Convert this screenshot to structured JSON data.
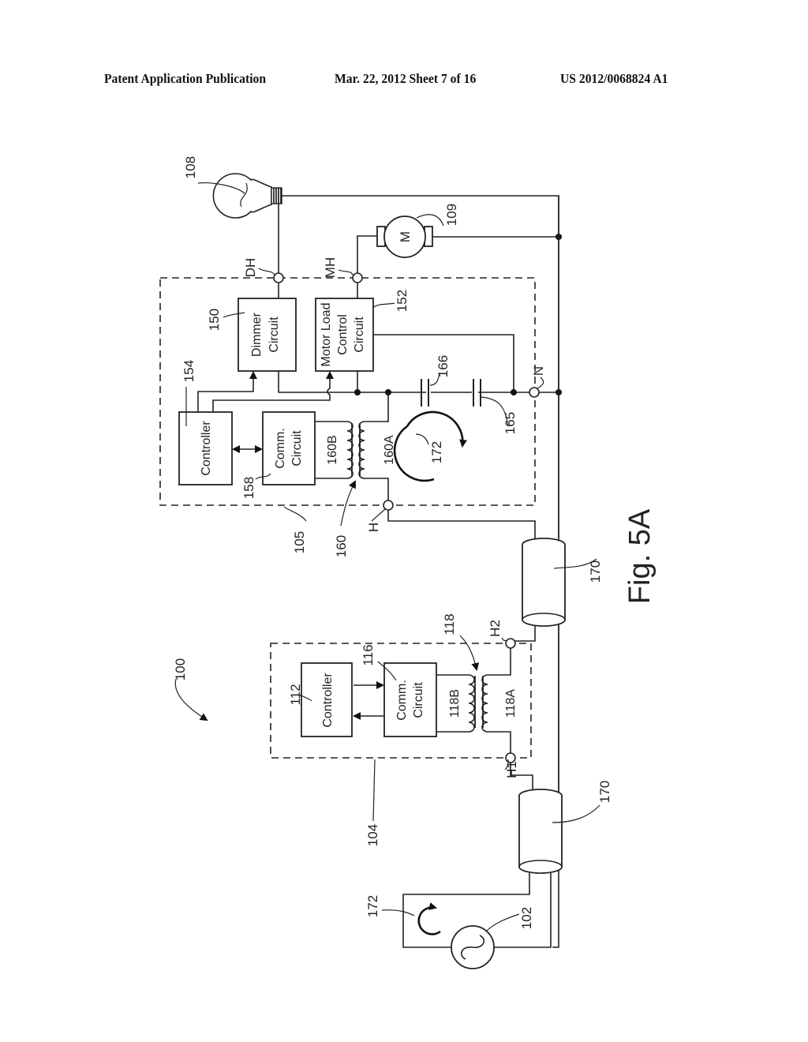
{
  "header": {
    "publication": "Patent Application Publication",
    "date_sheet": "Mar. 22, 2012  Sheet 7 of 16",
    "number": "US 2012/0068824 A1"
  },
  "figure": {
    "caption": "Fig. 5A",
    "system_ref": "100",
    "source": {
      "ref": "102",
      "loop_ref": "172"
    },
    "cables": [
      {
        "ref": "170"
      },
      {
        "ref": "170"
      }
    ],
    "device_104": {
      "ref": "104",
      "controller": {
        "ref": "112",
        "label": "Controller"
      },
      "comm": {
        "ref": "116",
        "line1": "Comm.",
        "line2": "Circuit"
      },
      "transformer": {
        "ref": "118",
        "primary": "118A",
        "secondary": "118B"
      },
      "terminals": [
        "H1",
        "H2"
      ]
    },
    "device_105": {
      "ref": "105",
      "controller": {
        "ref": "154",
        "label": "Controller"
      },
      "comm": {
        "ref": "158",
        "line1": "Comm.",
        "line2": "Circuit"
      },
      "dimmer": {
        "ref": "150",
        "line1": "Dimmer",
        "line2": "Circuit"
      },
      "motor_control": {
        "ref": "152",
        "line1": "Motor Load",
        "line2": "Control",
        "line3": "Circuit"
      },
      "transformer": {
        "ref": "160",
        "primary": "160A",
        "secondary": "160B"
      },
      "capacitors": [
        "166",
        "165"
      ],
      "loop_ref": "172",
      "terminals": [
        "H",
        "N",
        "DH",
        "MH"
      ]
    },
    "lamp": {
      "ref": "108"
    },
    "motor": {
      "ref": "109",
      "symbol": "M"
    }
  }
}
